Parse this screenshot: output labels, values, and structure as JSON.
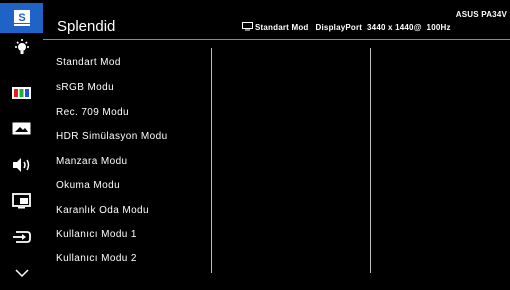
{
  "header": {
    "title": "Splendid",
    "current_mode": "Standart Mod",
    "input_info": "DisplayPort  3440 x 1440@  100Hz",
    "model": "ASUS PA34V"
  },
  "sidebar": {
    "items": [
      {
        "icon": "splendid-s-icon",
        "active": true
      },
      {
        "icon": "brightness-icon"
      },
      {
        "icon": "color-bars-icon"
      },
      {
        "icon": "image-icon"
      },
      {
        "icon": "speaker-icon"
      },
      {
        "icon": "pip-icon"
      },
      {
        "icon": "input-select-icon"
      },
      {
        "icon": "chevron-down-icon"
      }
    ]
  },
  "menu": {
    "items": [
      "Standart Mod",
      "sRGB Modu",
      "Rec. 709 Modu",
      "HDR Simülasyon Modu",
      "Manzara Modu",
      "Okuma Modu",
      "Karanlık Oda Modu",
      "Kullanıcı Modu 1",
      "Kullanıcı Modu 2"
    ]
  },
  "colors": {
    "active_accent": "#1f63c7",
    "background": "#000000",
    "text": "#ffffff",
    "divider": "#bdbdbd"
  }
}
